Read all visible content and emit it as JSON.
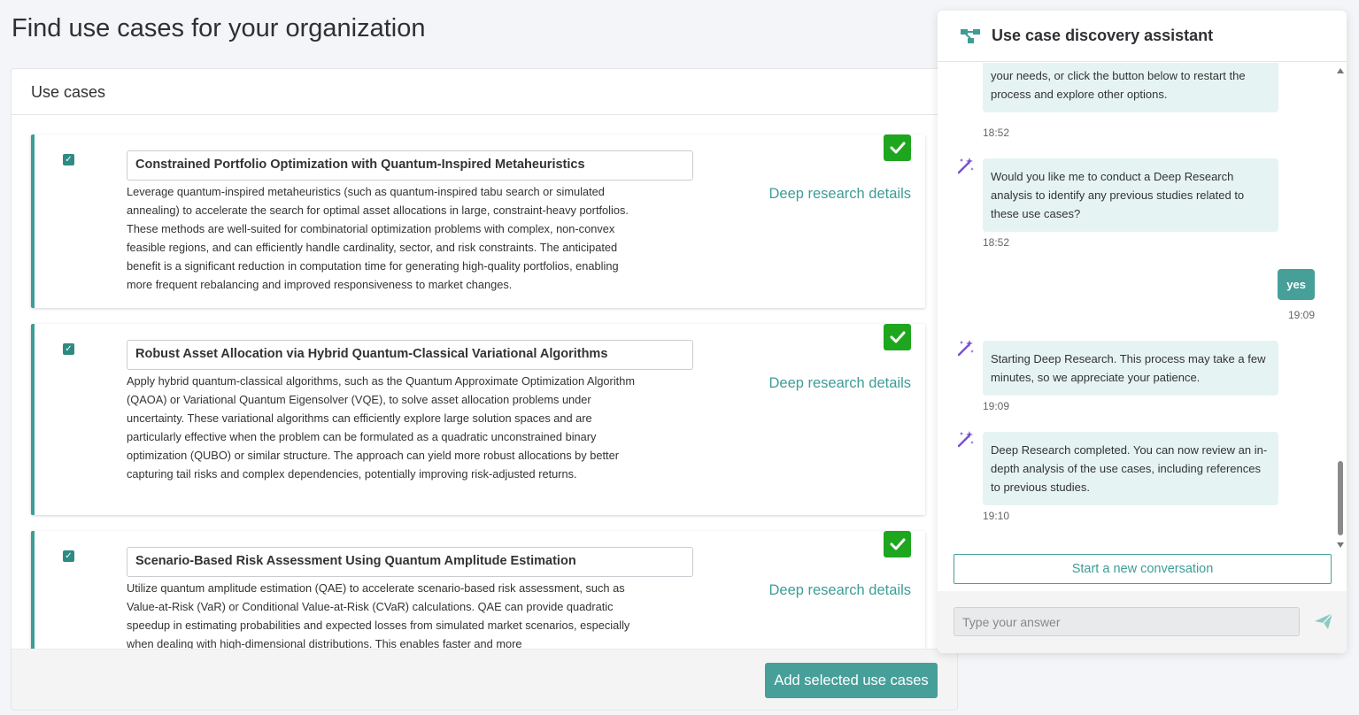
{
  "page": {
    "title": "Find use cases for your organization"
  },
  "use_cases_panel": {
    "header": "Use cases",
    "deep_research_link": "Deep research details",
    "add_button": "Add selected use cases",
    "items": [
      {
        "checked": true,
        "title": "Constrained Portfolio Optimization with Quantum-Inspired Metaheuristics",
        "description": "Leverage quantum-inspired metaheuristics (such as quantum-inspired tabu search or simulated annealing) to accelerate the search for optimal asset allocations in large, constraint-heavy portfolios. These methods are well-suited for combinatorial optimization problems with complex, non-convex feasible regions, and can efficiently handle cardinality, sector, and risk constraints. The anticipated benefit is a significant reduction in computation time for generating high-quality portfolios, enabling more frequent rebalancing and improved responsiveness to market changes."
      },
      {
        "checked": true,
        "title": "Robust Asset Allocation via Hybrid Quantum-Classical Variational Algorithms",
        "description": "Apply hybrid quantum-classical algorithms, such as the Quantum Approximate Optimization Algorithm (QAOA) or Variational Quantum Eigensolver (VQE), to solve asset allocation problems under uncertainty. These variational algorithms can efficiently explore large solution spaces and are particularly effective when the problem can be formulated as a quadratic unconstrained binary optimization (QUBO) or similar structure. The approach can yield more robust allocations by better capturing tail risks and complex dependencies, potentially improving risk-adjusted returns."
      },
      {
        "checked": true,
        "title": "Scenario-Based Risk Assessment Using Quantum Amplitude Estimation",
        "description": "Utilize quantum amplitude estimation (QAE) to accelerate scenario-based risk assessment, such as Value-at-Risk (VaR) or Conditional Value-at-Risk (CVaR) calculations. QAE can provide quadratic speedup in estimating probabilities and expected losses from simulated market scenarios, especially when dealing with high-dimensional distributions. This enables faster and more"
      }
    ]
  },
  "chat": {
    "title": "Use case discovery assistant",
    "messages": [
      {
        "role": "bot",
        "text": "your needs, or click the button below to restart the process and explore other options.",
        "time": "18:52"
      },
      {
        "role": "bot",
        "text": "Would you like me to conduct a Deep Research analysis to identify any previous studies related to these use cases?",
        "time": "18:52"
      },
      {
        "role": "user",
        "text": "yes",
        "time": "19:09"
      },
      {
        "role": "bot",
        "text": "Starting Deep Research. This process may take a few minutes, so we appreciate your patience.",
        "time": "19:09"
      },
      {
        "role": "bot",
        "text": "Deep Research completed. You can now review an in-depth analysis of the use cases, including references to previous studies.",
        "time": "19:10"
      }
    ],
    "new_conversation_button": "Start a new conversation",
    "input": {
      "value": "",
      "placeholder": "Type your answer"
    }
  },
  "colors": {
    "accent": "#479f99",
    "success": "#1fa61f",
    "bubble": "#e5f4f2",
    "bot_icon": "#7a4fd1"
  },
  "icons": {
    "header": "network-nodes-icon",
    "bot": "magic-wand-icon",
    "badge": "checkmark-icon",
    "send": "paper-plane-icon"
  }
}
